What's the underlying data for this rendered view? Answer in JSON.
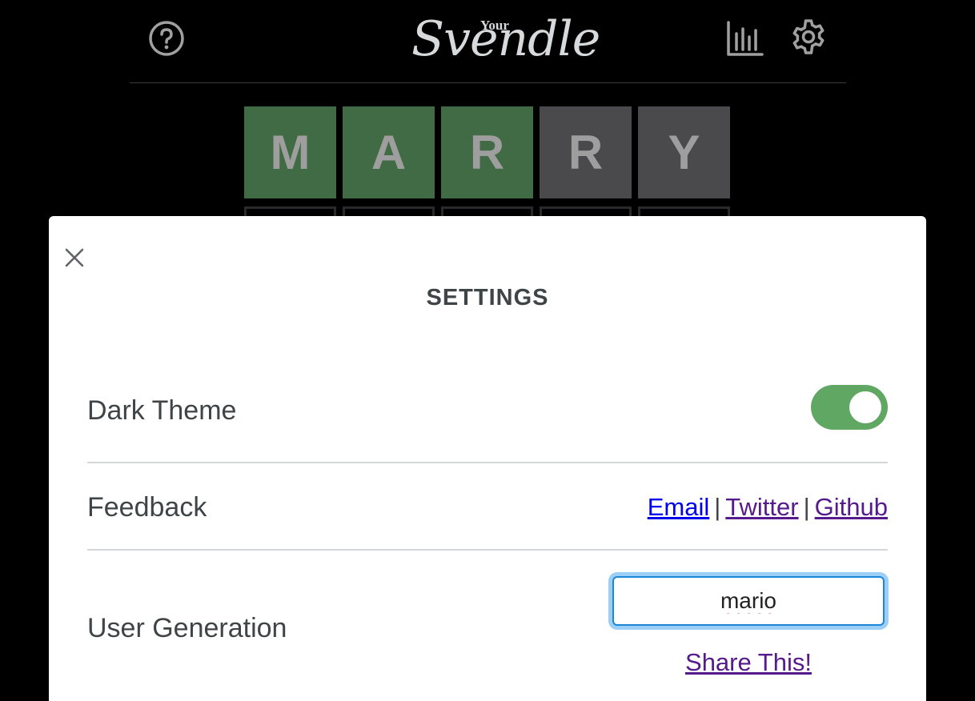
{
  "header": {
    "logo_small": "Your",
    "logo_name": "Svendle",
    "help_icon": "help-circle-icon",
    "stats_icon": "bar-chart-icon",
    "settings_icon": "gear-icon"
  },
  "board": {
    "rows": [
      [
        {
          "letter": "M",
          "state": "correct"
        },
        {
          "letter": "A",
          "state": "correct"
        },
        {
          "letter": "R",
          "state": "correct"
        },
        {
          "letter": "R",
          "state": "absent"
        },
        {
          "letter": "Y",
          "state": "absent"
        }
      ],
      [
        {
          "letter": "",
          "state": "empty"
        },
        {
          "letter": "",
          "state": "empty"
        },
        {
          "letter": "",
          "state": "empty"
        },
        {
          "letter": "",
          "state": "empty"
        },
        {
          "letter": "",
          "state": "empty"
        }
      ]
    ]
  },
  "settings_modal": {
    "title": "SETTINGS",
    "close_icon": "close-icon",
    "dark_theme": {
      "label": "Dark Theme",
      "enabled": true
    },
    "feedback": {
      "label": "Feedback",
      "links": [
        "Email",
        "Twitter",
        "Github"
      ],
      "separator": "|"
    },
    "user_generation": {
      "label": "User Generation",
      "input_value": "mario",
      "share_label": "Share This!"
    }
  },
  "colors": {
    "background": "#000000",
    "correct": "#416b44",
    "absent": "#4a4a4c",
    "toggle_on": "#60a764",
    "link": "#0000ee",
    "link_visited": "#551a8b"
  }
}
